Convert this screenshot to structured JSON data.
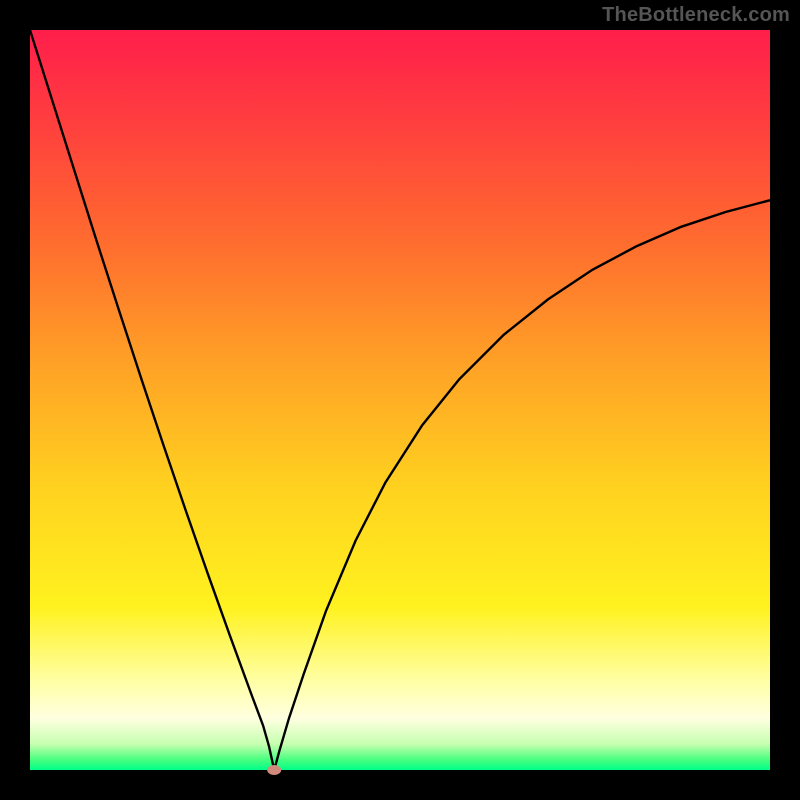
{
  "watermark": "TheBottleneck.com",
  "colors": {
    "frame_bg": "#000000",
    "curve_stroke": "#000000",
    "marker_fill": "#cf8a7c",
    "gradient_stops": [
      {
        "offset": 0.0,
        "color": "#ff1e4b"
      },
      {
        "offset": 0.12,
        "color": "#ff3d3f"
      },
      {
        "offset": 0.28,
        "color": "#ff6a2f"
      },
      {
        "offset": 0.45,
        "color": "#ffa126"
      },
      {
        "offset": 0.62,
        "color": "#ffd21f"
      },
      {
        "offset": 0.78,
        "color": "#fff21f"
      },
      {
        "offset": 0.88,
        "color": "#ffffa5"
      },
      {
        "offset": 0.93,
        "color": "#ffffe0"
      },
      {
        "offset": 0.965,
        "color": "#c6ffb0"
      },
      {
        "offset": 0.985,
        "color": "#4eff80"
      },
      {
        "offset": 1.0,
        "color": "#00ff88"
      }
    ]
  },
  "layout": {
    "image_size": 800,
    "plot_inset": 30
  },
  "chart_data": {
    "type": "line",
    "title": "",
    "xlabel": "",
    "ylabel": "",
    "xlim": [
      0,
      100
    ],
    "ylim": [
      0,
      100
    ],
    "min_point": {
      "x": 33,
      "y": 0
    },
    "series": [
      {
        "name": "bottleneck-curve",
        "x": [
          0,
          3,
          6,
          9,
          12,
          15,
          18,
          21,
          24,
          27,
          30,
          31.5,
          32.3,
          33,
          33.7,
          35,
          37,
          40,
          44,
          48,
          53,
          58,
          64,
          70,
          76,
          82,
          88,
          94,
          100
        ],
        "values": [
          100,
          90.5,
          81,
          71.5,
          62.2,
          53,
          44,
          35.2,
          26.6,
          18.2,
          10,
          6,
          3.2,
          0,
          2.6,
          7,
          13,
          21.5,
          31,
          38.8,
          46.6,
          52.8,
          58.8,
          63.6,
          67.6,
          70.8,
          73.4,
          75.4,
          77
        ]
      }
    ],
    "annotations": [
      {
        "name": "marker",
        "x": 33,
        "y": 0
      }
    ]
  }
}
